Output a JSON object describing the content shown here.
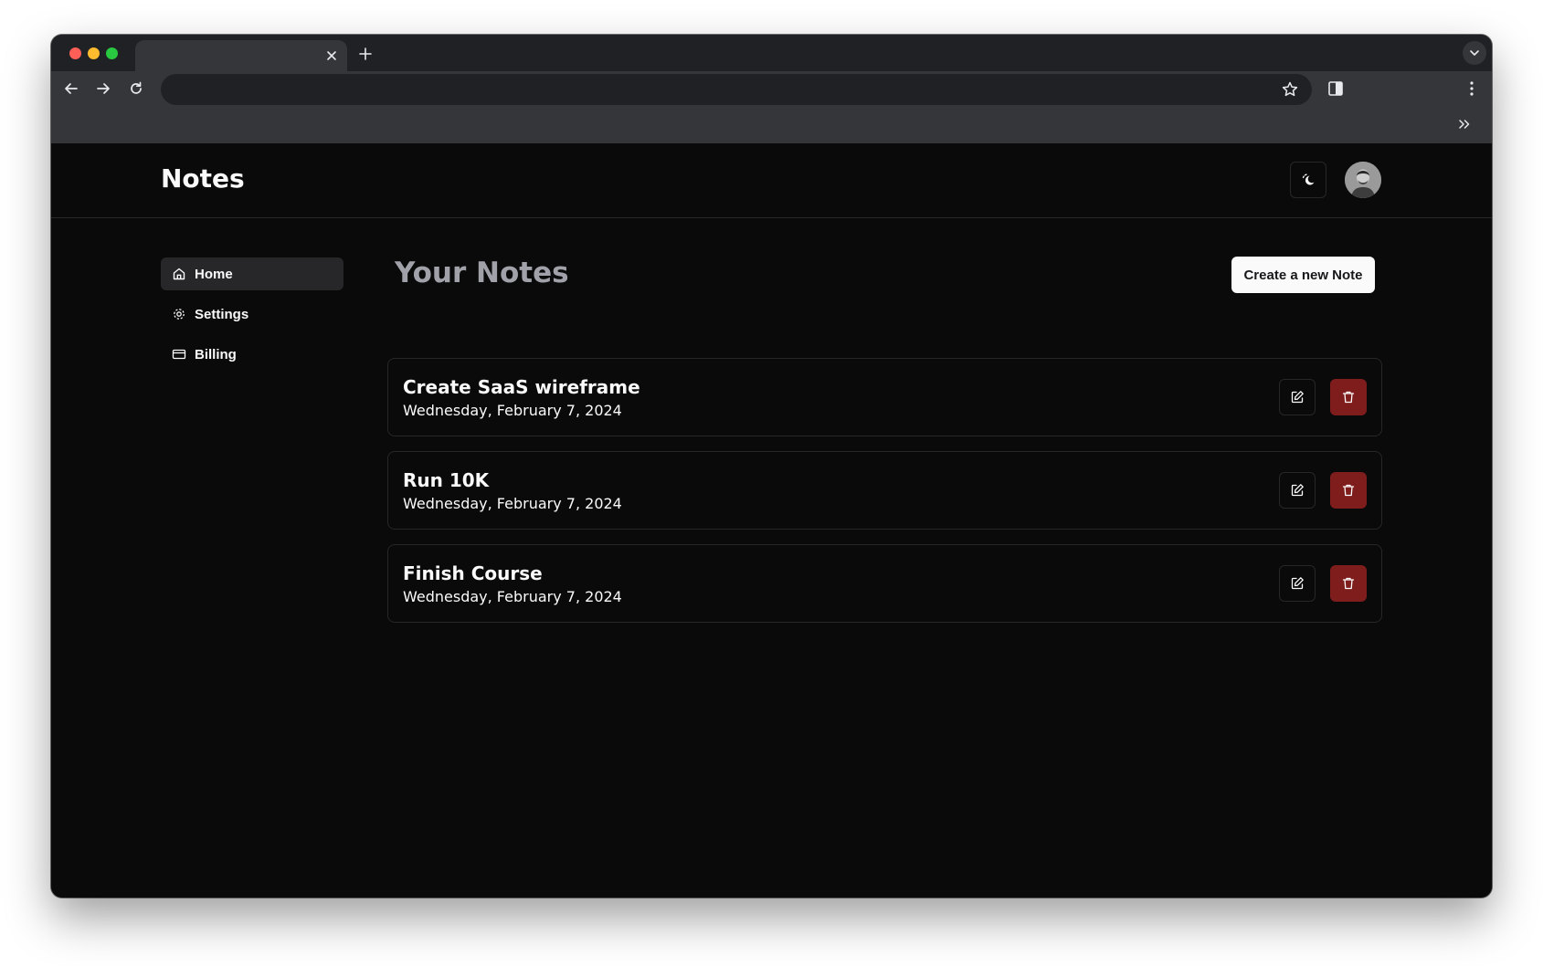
{
  "app": {
    "brand": "Notes"
  },
  "sidebar": {
    "items": [
      {
        "label": "Home",
        "icon": "home-icon",
        "active": true
      },
      {
        "label": "Settings",
        "icon": "settings-icon",
        "active": false
      },
      {
        "label": "Billing",
        "icon": "credit-card-icon",
        "active": false
      }
    ]
  },
  "main": {
    "title": "Your Notes",
    "create_label": "Create a new Note"
  },
  "notes": [
    {
      "title": "Create SaaS wireframe",
      "date": "Wednesday, February 7, 2024"
    },
    {
      "title": "Run 10K",
      "date": "Wednesday, February 7, 2024"
    },
    {
      "title": "Finish Course",
      "date": "Wednesday, February 7, 2024"
    }
  ],
  "colors": {
    "background": "#0a0a0b",
    "border": "#27272a",
    "delete": "#7f1d1d",
    "primary_button": "#fafafa"
  }
}
